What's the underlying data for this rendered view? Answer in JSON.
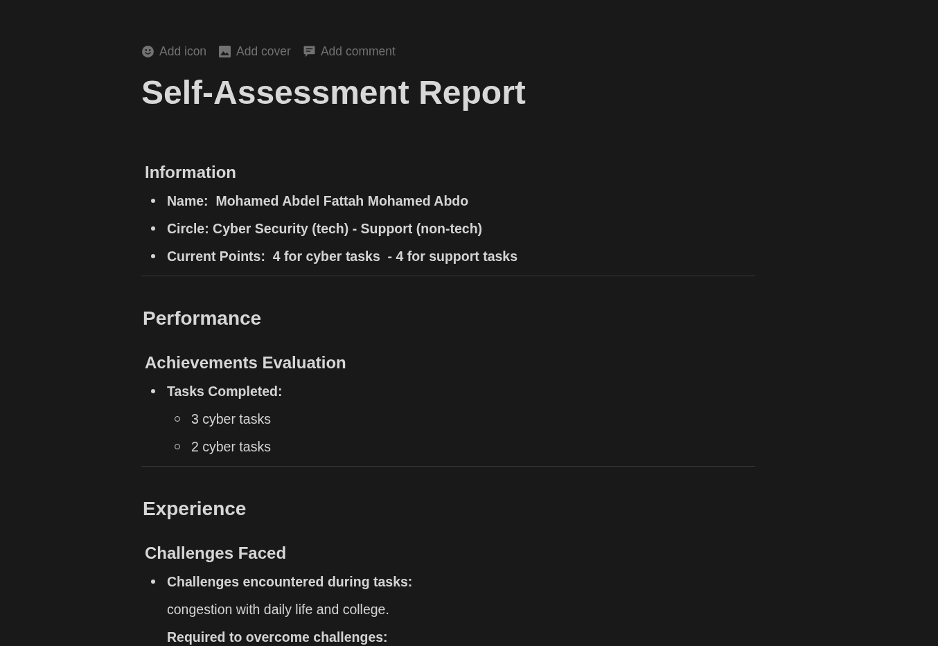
{
  "toolbar": [
    {
      "kind": "emoji",
      "label": "Add icon"
    },
    {
      "kind": "image",
      "label": "Add cover"
    },
    {
      "kind": "comment",
      "label": "Add comment"
    }
  ],
  "title": "Self-Assessment Report",
  "blocks": [
    {
      "kind": "subheading",
      "text": "Information"
    },
    {
      "kind": "bullet",
      "text": "Name:  Mohamed Abdel Fattah Mohamed Abdo",
      "bold": true
    },
    {
      "kind": "bullet",
      "text": "Circle: Cyber Security (tech) - Support (non-tech)",
      "bold": true
    },
    {
      "kind": "bullet",
      "text": "Current Points:  4 for cyber tasks  - 4 for support tasks",
      "bold": true
    },
    {
      "kind": "divider"
    },
    {
      "kind": "heading",
      "text": "Performance"
    },
    {
      "kind": "subheading",
      "text": "Achievements Evaluation"
    },
    {
      "kind": "bullet",
      "text": "Tasks Completed:",
      "bold": true,
      "children": [
        {
          "kind": "bullet",
          "text": "3 cyber tasks",
          "bold": false
        },
        {
          "kind": "bullet",
          "text": "2 cyber tasks",
          "bold": false
        }
      ]
    },
    {
      "kind": "divider"
    },
    {
      "kind": "heading",
      "text": "Experience"
    },
    {
      "kind": "subheading",
      "text": "Challenges Faced"
    },
    {
      "kind": "bullet",
      "text": "Challenges encountered during tasks:",
      "bold": true,
      "children": [
        {
          "kind": "paragraph",
          "text": "congestion with daily life and college.",
          "bold": false
        },
        {
          "kind": "paragraph",
          "text": "Required to overcome challenges:",
          "bold": true
        }
      ]
    }
  ]
}
